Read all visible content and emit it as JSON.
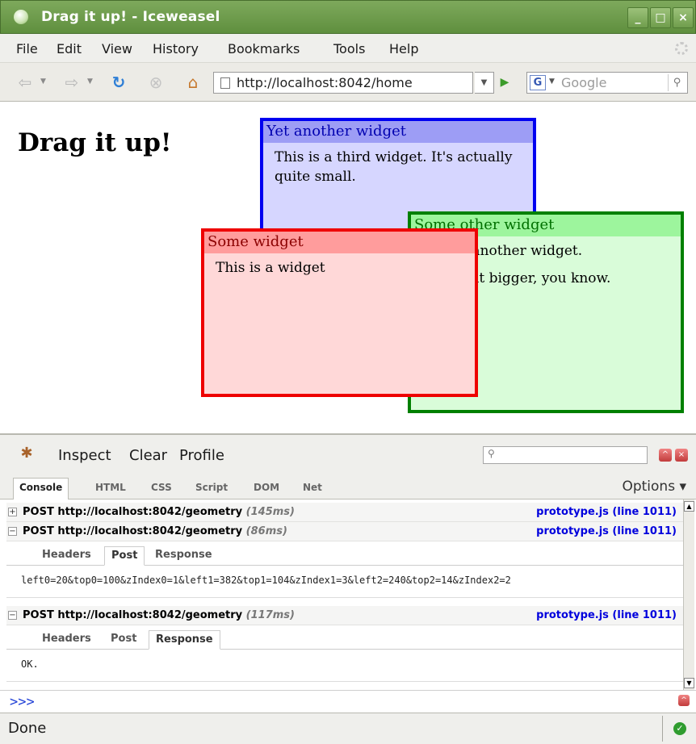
{
  "window": {
    "title": "Drag it up! - Iceweasel"
  },
  "menubar": {
    "items": [
      "File",
      "Edit",
      "View",
      "History",
      "Bookmarks",
      "Tools",
      "Help"
    ]
  },
  "navbar": {
    "url": "http://localhost:8042/home",
    "search_engine_letter": "G",
    "search_placeholder": "Google",
    "icons": [
      "back-icon",
      "forward-icon",
      "reload-icon",
      "stop-icon",
      "home-icon",
      "go-icon",
      "search-icon"
    ]
  },
  "page": {
    "heading": "Drag it up!",
    "widgets": {
      "blue": {
        "title": "Yet another widget",
        "body": [
          "This is a third widget. It's actually quite small."
        ]
      },
      "green": {
        "title": "Some other widget",
        "body": [
          "This is another widget.",
          "It is a bit bigger, you know."
        ]
      },
      "red": {
        "title": "Some widget",
        "body": [
          "This is a widget"
        ]
      }
    },
    "colors": {
      "blue_border": "#0000f0",
      "green_border": "#008000",
      "red_border": "#ee0000"
    }
  },
  "firebug": {
    "toolbar": {
      "inspect": "Inspect",
      "clear": "Clear",
      "profile": "Profile"
    },
    "tabs": [
      "Console",
      "HTML",
      "CSS",
      "Script",
      "DOM",
      "Net"
    ],
    "active_tab": "Console",
    "options_label": "Options",
    "requests": [
      {
        "method_url": "POST http://localhost:8042/geometry",
        "time": "(145ms)",
        "source": "prototype.js (line 1011)",
        "expanded": false
      },
      {
        "method_url": "POST http://localhost:8042/geometry",
        "time": "(86ms)",
        "source": "prototype.js (line 1011)",
        "expanded": true,
        "sub_tabs": [
          "Headers",
          "Post",
          "Response"
        ],
        "active_sub_tab": "Post",
        "body": "left0=20&top0=100&zIndex0=1&left1=382&top1=104&zIndex1=3&left2=240&top2=14&zIndex2=2"
      },
      {
        "method_url": "POST http://localhost:8042/geometry",
        "time": "(117ms)",
        "source": "prototype.js (line 1011)",
        "expanded": true,
        "sub_tabs": [
          "Headers",
          "Post",
          "Response"
        ],
        "active_sub_tab": "Response",
        "body": "OK."
      }
    ],
    "prompt": ">>>"
  },
  "statusbar": {
    "text": "Done"
  }
}
